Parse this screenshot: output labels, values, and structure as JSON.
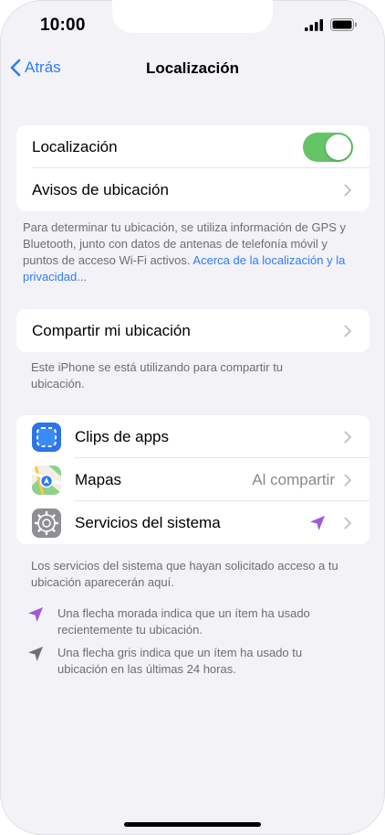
{
  "status_bar": {
    "time": "10:00"
  },
  "nav": {
    "back_label": "Atrás",
    "title": "Localización"
  },
  "group1": {
    "location_label": "Localización",
    "location_enabled": true,
    "alerts_label": "Avisos de ubicación"
  },
  "footnote1": {
    "text": "Para determinar tu ubicación, se utiliza información de GPS y Bluetooth, junto con datos de antenas de telefonía móvil y puntos de acceso Wi-Fi activos. ",
    "link": "Acerca de la localización y la privacidad..."
  },
  "group2": {
    "share_label": "Compartir mi ubicación"
  },
  "footnote2": {
    "text": "Este iPhone se está utilizando para compartir tu ubicación."
  },
  "apps": [
    {
      "label": "Clips de apps",
      "icon": "app-clips-icon"
    },
    {
      "label": "Mapas",
      "icon": "maps-icon",
      "value": "Al compartir"
    },
    {
      "label": "Servicios del sistema",
      "icon": "gear-icon"
    }
  ],
  "footnote3": {
    "text": "Los servicios del sistema que hayan solicitado acceso a tu ubicación aparecerán aquí."
  },
  "legend": [
    {
      "text": "Una flecha morada indica que un ítem ha usado recientemente tu ubicación.",
      "color": "#a259d9"
    },
    {
      "text": "Una flecha gris indica que un ítem ha usado tu ubicación en las últimas 24 horas.",
      "color": "#8e8e93"
    }
  ],
  "colors": {
    "accent": "#2f7cf6",
    "toggle_on": "#65c466",
    "purple_arrow": "#a259d9",
    "gray_arrow": "#8e8e93"
  }
}
